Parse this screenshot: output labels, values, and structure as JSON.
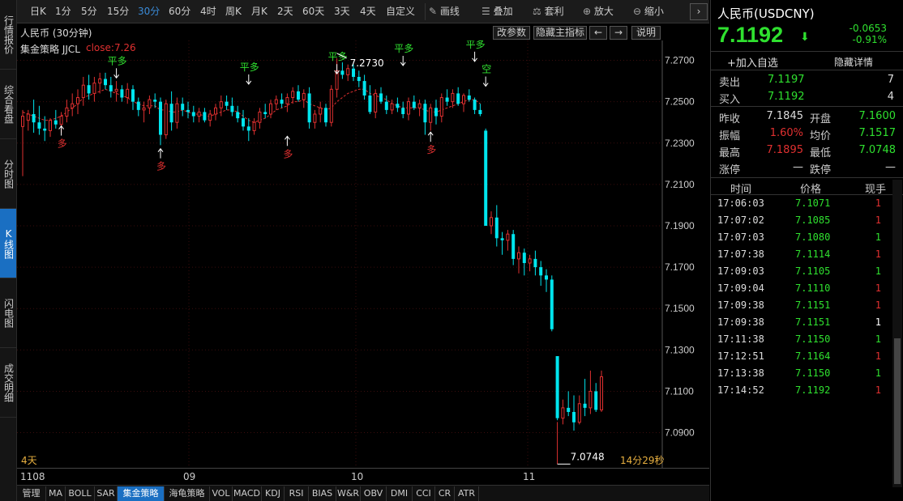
{
  "left_tabs": [
    "行情报价",
    "综合看盘",
    "分时图",
    "K线图",
    "闪电图",
    "成交明细"
  ],
  "toolbar": {
    "periods": [
      "日K",
      "1分",
      "5分",
      "15分",
      "30分",
      "60分",
      "4时",
      "周K",
      "月K",
      "2天",
      "60天",
      "3天",
      "4天",
      "自定义"
    ],
    "active_period": "30分",
    "tools": [
      {
        "label": "画线",
        "icon": "pencil-icon"
      },
      {
        "label": "叠加",
        "icon": "stack-icon"
      },
      {
        "label": "套利",
        "icon": "arbitrage-icon"
      },
      {
        "label": "放大",
        "icon": "zoom-in-icon"
      },
      {
        "label": "缩小",
        "icon": "zoom-out-icon"
      }
    ],
    "more": "›"
  },
  "chart_header": {
    "title": "人民币 (30分钟)",
    "buttons": [
      "改参数",
      "隐藏主指标",
      "←",
      "→",
      "说明"
    ]
  },
  "strategy": {
    "name": "集金策略 JJCL",
    "close_label": "close:7.26"
  },
  "chart_data": {
    "type": "candlestick",
    "x_tick_labels": [
      "1108",
      "09",
      "10",
      "11"
    ],
    "y_tick_labels": [
      "7.2700",
      "7.2500",
      "7.2300",
      "7.2100",
      "7.1900",
      "7.1700",
      "7.1500",
      "7.1300",
      "7.1100",
      "7.0900"
    ],
    "ylim": [
      7.073,
      7.2796
    ],
    "candles": [
      [
        7.238,
        7.246,
        7.214,
        7.243
      ],
      [
        7.241,
        7.246,
        7.236,
        7.244
      ],
      [
        7.244,
        7.251,
        7.235,
        7.24
      ],
      [
        7.24,
        7.248,
        7.234,
        7.237
      ],
      [
        7.237,
        7.243,
        7.231,
        7.236
      ],
      [
        7.236,
        7.242,
        7.233,
        7.241
      ],
      [
        7.241,
        7.246,
        7.237,
        7.239
      ],
      [
        7.239,
        7.245,
        7.235,
        7.243
      ],
      [
        7.243,
        7.251,
        7.24,
        7.247
      ],
      [
        7.247,
        7.254,
        7.243,
        7.249
      ],
      [
        7.249,
        7.256,
        7.244,
        7.252
      ],
      [
        7.252,
        7.262,
        7.248,
        7.258
      ],
      [
        7.258,
        7.263,
        7.251,
        7.254
      ],
      [
        7.254,
        7.262,
        7.25,
        7.259
      ],
      [
        7.259,
        7.264,
        7.254,
        7.261
      ],
      [
        7.261,
        7.264,
        7.256,
        7.258
      ],
      [
        7.258,
        7.262,
        7.252,
        7.255
      ],
      [
        7.255,
        7.26,
        7.25,
        7.256
      ],
      [
        7.256,
        7.258,
        7.25,
        7.252
      ],
      [
        7.252,
        7.259,
        7.249,
        7.256
      ],
      [
        7.256,
        7.258,
        7.246,
        7.25
      ],
      [
        7.25,
        7.252,
        7.243,
        7.246
      ],
      [
        7.246,
        7.25,
        7.24,
        7.247
      ],
      [
        7.247,
        7.253,
        7.244,
        7.251
      ],
      [
        7.251,
        7.254,
        7.247,
        7.25
      ],
      [
        7.25,
        7.252,
        7.229,
        7.234
      ],
      [
        7.234,
        7.251,
        7.232,
        7.249
      ],
      [
        7.249,
        7.255,
        7.236,
        7.24
      ],
      [
        7.24,
        7.252,
        7.237,
        7.249
      ],
      [
        7.249,
        7.252,
        7.243,
        7.246
      ],
      [
        7.246,
        7.25,
        7.242,
        7.245
      ],
      [
        7.245,
        7.248,
        7.24,
        7.243
      ],
      [
        7.243,
        7.247,
        7.24,
        7.245
      ],
      [
        7.245,
        7.247,
        7.24,
        7.241
      ],
      [
        7.241,
        7.246,
        7.238,
        7.244
      ],
      [
        7.244,
        7.249,
        7.241,
        7.247
      ],
      [
        7.247,
        7.253,
        7.243,
        7.25
      ],
      [
        7.25,
        7.253,
        7.246,
        7.248
      ],
      [
        7.248,
        7.252,
        7.243,
        7.245
      ],
      [
        7.245,
        7.248,
        7.24,
        7.242
      ],
      [
        7.242,
        7.246,
        7.236,
        7.238
      ],
      [
        7.238,
        7.242,
        7.231,
        7.236
      ],
      [
        7.236,
        7.242,
        7.234,
        7.24
      ],
      [
        7.24,
        7.247,
        7.237,
        7.245
      ],
      [
        7.245,
        7.249,
        7.242,
        7.244
      ],
      [
        7.244,
        7.251,
        7.242,
        7.249
      ],
      [
        7.249,
        7.253,
        7.246,
        7.251
      ],
      [
        7.251,
        7.254,
        7.247,
        7.249
      ],
      [
        7.249,
        7.254,
        7.245,
        7.252
      ],
      [
        7.252,
        7.257,
        7.249,
        7.255
      ],
      [
        7.255,
        7.258,
        7.25,
        7.251
      ],
      [
        7.251,
        7.256,
        7.247,
        7.254
      ],
      [
        7.254,
        7.257,
        7.237,
        7.24
      ],
      [
        7.24,
        7.246,
        7.237,
        7.244
      ],
      [
        7.244,
        7.25,
        7.24,
        7.247
      ],
      [
        7.247,
        7.249,
        7.238,
        7.24
      ],
      [
        7.24,
        7.258,
        7.238,
        7.256
      ],
      [
        7.256,
        7.271,
        7.252,
        7.265
      ],
      [
        7.265,
        7.269,
        7.261,
        7.263
      ],
      [
        7.263,
        7.268,
        7.26,
        7.266
      ],
      [
        7.266,
        7.268,
        7.26,
        7.262
      ],
      [
        7.262,
        7.265,
        7.257,
        7.26
      ],
      [
        7.26,
        7.263,
        7.251,
        7.253
      ],
      [
        7.253,
        7.258,
        7.244,
        7.245
      ],
      [
        7.245,
        7.256,
        7.242,
        7.254
      ],
      [
        7.254,
        7.257,
        7.249,
        7.25
      ],
      [
        7.25,
        7.253,
        7.244,
        7.246
      ],
      [
        7.246,
        7.251,
        7.244,
        7.249
      ],
      [
        7.249,
        7.252,
        7.245,
        7.247
      ],
      [
        7.247,
        7.25,
        7.242,
        7.244
      ],
      [
        7.244,
        7.252,
        7.241,
        7.25
      ],
      [
        7.25,
        7.253,
        7.246,
        7.247
      ],
      [
        7.247,
        7.251,
        7.243,
        7.249
      ],
      [
        7.249,
        7.251,
        7.234,
        7.24
      ],
      [
        7.24,
        7.249,
        7.236,
        7.247
      ],
      [
        7.247,
        7.251,
        7.239,
        7.243
      ],
      [
        7.243,
        7.254,
        7.24,
        7.252
      ],
      [
        7.252,
        7.256,
        7.248,
        7.25
      ],
      [
        7.25,
        7.256,
        7.247,
        7.254
      ],
      [
        7.254,
        7.257,
        7.248,
        7.249
      ],
      [
        7.249,
        7.254,
        7.245,
        7.253
      ],
      [
        7.253,
        7.256,
        7.25,
        7.251
      ],
      [
        7.251,
        7.252,
        7.244,
        7.246
      ],
      [
        7.246,
        7.249,
        7.243,
        7.244
      ],
      [
        7.236,
        7.237,
        7.191,
        7.19
      ],
      [
        7.19,
        7.197,
        7.186,
        7.194
      ],
      [
        7.194,
        7.2,
        7.18,
        7.184
      ],
      [
        7.184,
        7.187,
        7.176,
        7.183
      ],
      [
        7.183,
        7.188,
        7.178,
        7.186
      ],
      [
        7.186,
        7.188,
        7.171,
        7.174
      ],
      [
        7.174,
        7.18,
        7.167,
        7.177
      ],
      [
        7.177,
        7.179,
        7.166,
        7.172
      ],
      [
        7.172,
        7.176,
        7.168,
        7.174
      ],
      [
        7.174,
        7.178,
        7.166,
        7.17
      ],
      [
        7.17,
        7.173,
        7.161,
        7.166
      ],
      [
        7.166,
        7.169,
        7.158,
        7.164
      ],
      [
        7.164,
        7.166,
        7.139,
        7.14
      ],
      [
        7.127,
        7.127,
        7.096,
        7.097
      ],
      [
        7.097,
        7.106,
        7.094,
        7.102
      ],
      [
        7.102,
        7.11,
        7.098,
        7.1
      ],
      [
        7.1,
        7.108,
        7.091,
        7.095
      ],
      [
        7.095,
        7.108,
        7.094,
        7.104
      ],
      [
        7.104,
        7.116,
        7.098,
        7.102
      ],
      [
        7.102,
        7.12,
        7.099,
        7.11
      ],
      [
        7.11,
        7.114,
        7.1,
        7.101
      ],
      [
        7.101,
        7.12,
        7.1,
        7.117
      ]
    ],
    "ma_line": [
      7.245,
      7.244,
      7.243,
      7.242,
      7.241,
      7.241,
      7.242,
      7.243,
      7.245,
      7.247,
      7.249,
      7.252,
      7.253,
      7.254,
      7.255,
      7.256,
      7.255,
      7.254,
      7.253,
      7.252,
      7.25,
      7.249,
      7.248,
      7.248,
      7.248,
      7.246,
      7.246,
      7.245,
      7.245,
      7.246,
      7.245,
      7.244,
      7.244,
      7.243,
      7.243,
      7.244,
      7.245,
      7.246,
      7.246,
      7.245,
      7.243,
      7.241,
      7.24,
      7.241,
      7.242,
      7.244,
      7.246,
      7.247,
      7.248,
      7.25,
      7.25,
      7.251,
      7.249,
      7.248,
      7.247,
      7.246,
      7.247,
      7.25,
      7.252,
      7.254,
      7.255,
      7.256,
      7.256,
      7.254,
      7.253,
      7.252,
      7.251,
      7.249,
      7.248,
      7.247,
      7.247,
      7.247,
      7.247,
      7.246,
      7.245,
      7.245,
      7.246,
      7.247,
      7.248,
      7.249,
      7.25,
      7.251,
      7.251,
      7.249
    ],
    "signals": [
      {
        "idx": 7,
        "type": "buy",
        "label": "多",
        "pos": "below",
        "price": 7.243
      },
      {
        "idx": 17,
        "type": "close",
        "label": "平多",
        "pos": "above",
        "price": 7.256
      },
      {
        "idx": 25,
        "type": "buy",
        "label": "多",
        "pos": "below",
        "price": 7.232
      },
      {
        "idx": 41,
        "type": "close",
        "label": "平多",
        "pos": "above",
        "price": 7.253
      },
      {
        "idx": 48,
        "type": "buy",
        "label": "多",
        "pos": "below",
        "price": 7.238
      },
      {
        "idx": 57,
        "type": "close",
        "label": "平多",
        "pos": "above",
        "price": 7.258
      },
      {
        "idx": 69,
        "type": "close",
        "label": "平多",
        "pos": "above",
        "price": 7.262
      },
      {
        "idx": 74,
        "type": "buy",
        "label": "多",
        "pos": "below",
        "price": 7.24
      },
      {
        "idx": 82,
        "type": "close",
        "label": "平多",
        "pos": "above",
        "price": 7.264
      },
      {
        "idx": 84,
        "type": "sell",
        "label": "空",
        "pos": "above",
        "price": 7.252
      }
    ],
    "annotations": [
      {
        "text": "7.2730",
        "idx": 57,
        "price": 7.273,
        "kind": "high"
      },
      {
        "text": "7.0748",
        "idx": 97,
        "price": 7.0748,
        "kind": "low"
      }
    ]
  },
  "duration_label": "4天",
  "countdown": "14分29秒",
  "bottom_tabs": [
    "管理",
    "MA",
    "BOLL",
    "SAR",
    "集金策略",
    "海龟策略",
    "VOL",
    "MACD",
    "KDJ",
    "RSI",
    "BIAS",
    "W&R",
    "OBV",
    "DMI",
    "CCI",
    "CR",
    "ATR"
  ],
  "active_bottom_tab": "集金策略",
  "quote": {
    "name": "人民币(USDCNY)",
    "price": "7.1192",
    "change": "-0.0653",
    "change_pct": "-0.91%",
    "arrow": "⬇",
    "add_watch": "+加入自选",
    "hide_detail": "隐藏详情",
    "sell_label": "卖出",
    "sell_price": "7.1197",
    "sell_vol": "7",
    "buy_label": "买入",
    "buy_price": "7.1192",
    "buy_vol": "4",
    "stats": [
      {
        "l1": "昨收",
        "v1": "7.1845",
        "c1": "#ddd",
        "l2": "开盘",
        "v2": "7.1600",
        "c2": "#2fe02f"
      },
      {
        "l1": "振幅",
        "v1": "1.60%",
        "c1": "#e03030",
        "l2": "均价",
        "v2": "7.1517",
        "c2": "#2fe02f"
      },
      {
        "l1": "最高",
        "v1": "7.1895",
        "c1": "#e03030",
        "l2": "最低",
        "v2": "7.0748",
        "c2": "#2fe02f"
      },
      {
        "l1": "涨停",
        "v1": "—",
        "c1": "#ddd",
        "l2": "跌停",
        "v2": "—",
        "c2": "#ddd"
      }
    ]
  },
  "trades_header": {
    "time": "时间",
    "price": "价格",
    "vol": "现手"
  },
  "trades": [
    {
      "time": "17:06:03",
      "price": "7.1071",
      "vol": "1",
      "vol_color": "#e03030"
    },
    {
      "time": "17:07:02",
      "price": "7.1085",
      "vol": "1",
      "vol_color": "#e03030"
    },
    {
      "time": "17:07:03",
      "price": "7.1080",
      "vol": "1",
      "vol_color": "#2fe02f"
    },
    {
      "time": "17:07:38",
      "price": "7.1114",
      "vol": "1",
      "vol_color": "#e03030"
    },
    {
      "time": "17:09:03",
      "price": "7.1105",
      "vol": "1",
      "vol_color": "#2fe02f"
    },
    {
      "time": "17:09:04",
      "price": "7.1110",
      "vol": "1",
      "vol_color": "#e03030"
    },
    {
      "time": "17:09:38",
      "price": "7.1151",
      "vol": "1",
      "vol_color": "#e03030"
    },
    {
      "time": "17:09:38",
      "price": "7.1151",
      "vol": "1",
      "vol_color": "#ffffff"
    },
    {
      "time": "17:11:38",
      "price": "7.1150",
      "vol": "1",
      "vol_color": "#2fe02f"
    },
    {
      "time": "17:12:51",
      "price": "7.1164",
      "vol": "1",
      "vol_color": "#e03030"
    },
    {
      "time": "17:13:38",
      "price": "7.1150",
      "vol": "1",
      "vol_color": "#2fe02f"
    },
    {
      "time": "17:14:52",
      "price": "7.1192",
      "vol": "1",
      "vol_color": "#e03030"
    }
  ],
  "colors": {
    "up": "#e03030",
    "down": "#00e5ee",
    "green": "#2fe02f",
    "accent": "#1a6fc2",
    "signal_buy": "#e03030",
    "signal_close": "#2fe02f"
  }
}
